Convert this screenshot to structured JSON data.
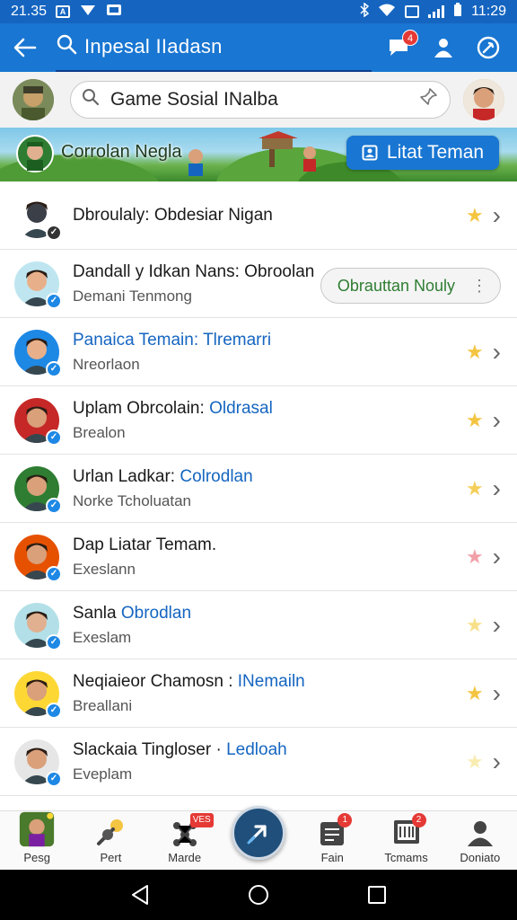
{
  "status_bar": {
    "time_left": "21.35",
    "time_right": "11:29"
  },
  "app_bar": {
    "search_text": "Inpesal IIadasn",
    "notification_badge": "4"
  },
  "search": {
    "value": "Game Sosial INalba"
  },
  "banner": {
    "title": "Corrolan Negla",
    "button_label": "Litat Teman"
  },
  "contacts": [
    {
      "name": "Dbroulaly: Obdesiar Nigan",
      "name_highlight": "",
      "subtitle": "",
      "star_color": "#f4c542",
      "face": "#3a3f48",
      "bg": "#fff"
    },
    {
      "name": "Dandall y Idkan Nans: Obroolan",
      "name_highlight": "",
      "subtitle": "Demani Tenmong",
      "action_label": "Obrauttan Nouly",
      "face": "#e8b08a",
      "bg": "#bfe6f0"
    },
    {
      "name": "Panaica Temain: ",
      "name_highlight": "Tlremarri",
      "subtitle": "Nreorlaon",
      "star_color": "#f4c542",
      "face": "#e8b08a",
      "bg": "#1e88e5",
      "name_color": "#1565c0"
    },
    {
      "name": "Uplam Obrcolain: ",
      "name_highlight": "Oldrasal",
      "subtitle": "Brealon",
      "star_color": "#f4c542",
      "face": "#d9a07a",
      "bg": "#c62828"
    },
    {
      "name": "Urlan Ladkar: ",
      "name_highlight": "Colrodlan",
      "subtitle": "Norke Tcholuatan",
      "star_color": "#f6cf5a",
      "face": "#d9a07a",
      "bg": "#2e7d32"
    },
    {
      "name": "Dap Liatar Temam.",
      "name_highlight": "",
      "subtitle": "Exeslann",
      "star_color": "#f2a0a8",
      "face": "#d9a07a",
      "bg": "#e65100"
    },
    {
      "name": "Sanla ",
      "name_highlight": "Obrodlan",
      "subtitle": "Exeslam",
      "star_color": "#f8e08a",
      "face": "#e0b090",
      "bg": "#b3e0e8"
    },
    {
      "name": "Neqiaieor Chamosn : ",
      "name_highlight": "INemailn",
      "subtitle": "Breallani",
      "star_color": "#f4c542",
      "face": "#d9a07a",
      "bg": "#fdd835"
    },
    {
      "name": "Slackaia Tingloser · ",
      "name_highlight": "Ledloah",
      "subtitle": "Eveplam",
      "star_color": "#f8ecb0",
      "face": "#d9a07a",
      "bg": "#e6e6e6"
    }
  ],
  "bottom_nav": {
    "items": [
      {
        "label": "Pesg"
      },
      {
        "label": "Pert"
      },
      {
        "label": "Marde",
        "badge": "VES"
      },
      {
        "label": ""
      },
      {
        "label": "Fain",
        "badge": "1"
      },
      {
        "label": "Tcmams",
        "badge": "2"
      },
      {
        "label": "Doniato"
      }
    ]
  },
  "colors": {
    "primary": "#1976d2",
    "status": "#1565c0",
    "accent_green": "#2e7d32",
    "badge_red": "#e53935"
  },
  "icons": {
    "back": "arrow-left-icon",
    "search": "search-icon",
    "chat": "chat-bubble-icon",
    "profile": "person-icon",
    "compass": "compass-icon",
    "pin": "pin-icon",
    "star": "star-icon",
    "chevron": "chevron-right-icon",
    "fab": "share-arrow-icon"
  }
}
